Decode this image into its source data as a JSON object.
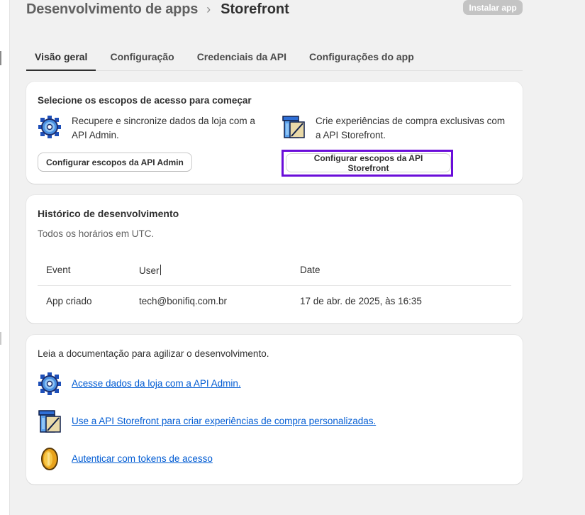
{
  "header": {
    "breadcrumb_parent": "Desenvolvimento de apps",
    "breadcrumb_separator": "›",
    "breadcrumb_current": "Storefront",
    "install_button": "Instalar app"
  },
  "tabs": [
    {
      "label": "Visão geral",
      "active": true
    },
    {
      "label": "Configuração",
      "active": false
    },
    {
      "label": "Credenciais da API",
      "active": false
    },
    {
      "label": "Configurações do app",
      "active": false
    }
  ],
  "scopes_card": {
    "title": "Selecione os escopos de acesso para começar",
    "admin_icon": "gear-icon",
    "admin_text": "Recupere e sincronize dados da loja com a API Admin.",
    "admin_button": "Configurar escopos da API Admin",
    "storefront_icon": "storefront-icon",
    "storefront_text": "Crie experiências de compra exclusivas com a API Storefront.",
    "storefront_button": "Configurar escopos da API Storefront",
    "highlight_color": "#6a0dd9"
  },
  "history_card": {
    "title": "Histórico de desenvolvimento",
    "subtitle": "Todos os horários em UTC.",
    "columns": [
      "Event",
      "User",
      "Date"
    ],
    "rows": [
      {
        "event": "App criado",
        "user": "tech@bonifiq.com.br",
        "date": "17 de abr. de 2025, às 16:35"
      }
    ]
  },
  "docs_card": {
    "intro": "Leia a documentação para agilizar o desenvolvimento.",
    "links": [
      {
        "icon": "gear-icon",
        "label": "Acesse dados da loja com a API Admin."
      },
      {
        "icon": "storefront-icon",
        "label": "Use a API Storefront para criar experiências de compra personalizadas."
      },
      {
        "icon": "coin-icon",
        "label": "Autenticar com tokens de acesso"
      }
    ]
  },
  "colors": {
    "background": "#f1f1f1",
    "link": "#005bd3",
    "install_button_bg": "#c4c4c4"
  }
}
